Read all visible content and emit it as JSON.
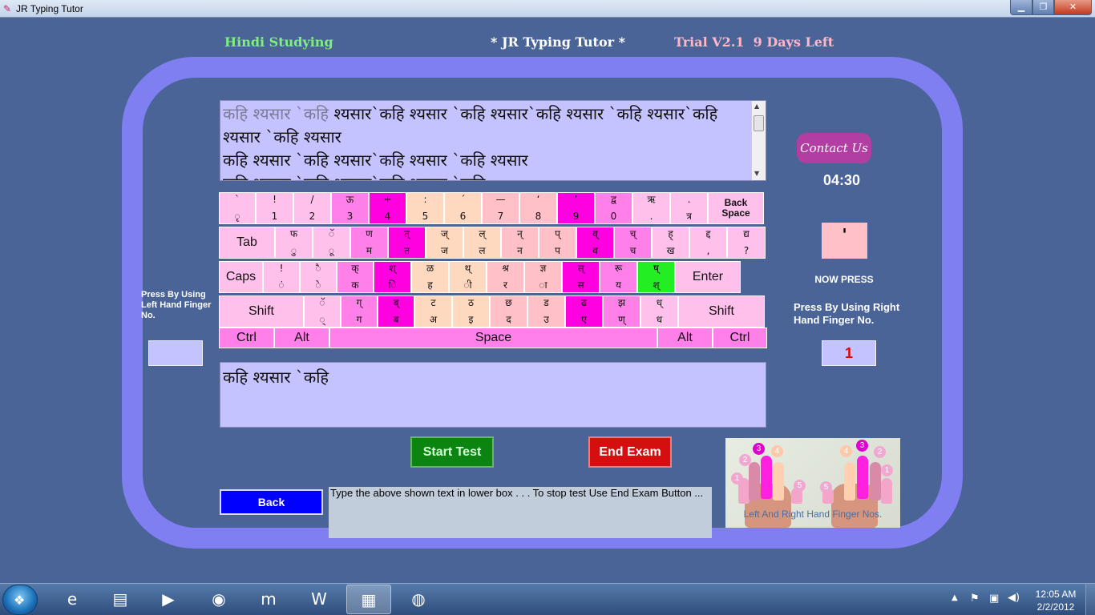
{
  "window": {
    "title": "JR Typing Tutor",
    "icon": "jr-app-icon",
    "min": "▁",
    "max": "❐",
    "close": "✕"
  },
  "header": {
    "mode": "Hindi Studying",
    "app_name": "* JR Typing Tutor *",
    "trial": "Trial V2.1  9 Days Left"
  },
  "source": {
    "typed": "कहि श्यसार `कहि",
    "remaining": " श्यसार`कहि श्यसार `कहि श्यसार`कहि श्यसार `कहि श्यसार`कहि श्यसार `कहि श्यसार\nकहि श्यसार `कहि श्यसार`कहि श्यसार `कहि श्यसार\nकहि श्यसार `कहि श्यसार`कहि श्यसार `कहि",
    "scroll_up": "▲",
    "scroll_down": "▼"
  },
  "keyboard": {
    "rows": [
      [
        {
          "top": "`",
          "bot": "ृ",
          "color": "#ffc0ec"
        },
        {
          "top": "!",
          "bot": "1",
          "color": "#ffc0ec"
        },
        {
          "top": "/",
          "bot": "2",
          "color": "#ffc0ec"
        },
        {
          "top": "ऊ",
          "bot": "3",
          "color": "#ff80e8"
        },
        {
          "top": "+",
          "bot": "4",
          "color": "#ff00e0"
        },
        {
          "top": ":",
          "bot": "5",
          "color": "#ffd8c0"
        },
        {
          "top": "´",
          "bot": "6",
          "color": "#ffd8c0"
        },
        {
          "top": "—",
          "bot": "7",
          "color": "#ffc0c8"
        },
        {
          "top": "‘",
          "bot": "8",
          "color": "#ffc0c8"
        },
        {
          "top": "’",
          "bot": "9",
          "color": "#ff00e0"
        },
        {
          "top": "द्व",
          "bot": "0",
          "color": "#ff80e8"
        },
        {
          "top": "ऋ",
          "bot": ".",
          "color": "#ffc0ec"
        },
        {
          "top": ".",
          "bot": "त्र",
          "color": "#ffc0ec"
        },
        {
          "label": "Back\nSpace",
          "color": "#ffc0ec",
          "name": "backspace"
        }
      ],
      [
        {
          "label": "Tab",
          "color": "#ffc0ec",
          "name": "tab"
        },
        {
          "top": "फ",
          "bot": "ु",
          "color": "#ffc0ec"
        },
        {
          "top": "ॅ",
          "bot": "ू",
          "color": "#ffc0ec"
        },
        {
          "top": "ण",
          "bot": "म",
          "color": "#ff80e8"
        },
        {
          "top": "त्",
          "bot": "त",
          "color": "#ff00e0"
        },
        {
          "top": "ज्",
          "bot": "ज",
          "color": "#ffd8c0"
        },
        {
          "top": "ल्",
          "bot": "ल",
          "color": "#ffd8c0"
        },
        {
          "top": "न्",
          "bot": "न",
          "color": "#ffc0c8"
        },
        {
          "top": "प्",
          "bot": "प",
          "color": "#ffc0c8"
        },
        {
          "top": "व्",
          "bot": "व",
          "color": "#ff00e0"
        },
        {
          "top": "च्",
          "bot": "च",
          "color": "#ff80e8"
        },
        {
          "top": "ह्",
          "bot": "ख",
          "color": "#ffc0ec"
        },
        {
          "top": "द्द",
          "bot": ",",
          "color": "#ffc0ec"
        },
        {
          "top": "द्य",
          "bot": "?",
          "color": "#ffc0ec"
        }
      ],
      [
        {
          "label": "Caps",
          "color": "#ffc0ec",
          "name": "caps"
        },
        {
          "top": "!",
          "bot": "ं",
          "color": "#ffc0ec"
        },
        {
          "top": "ै",
          "bot": "े",
          "color": "#ffc0ec"
        },
        {
          "top": "क्",
          "bot": "क",
          "color": "#ff80e8"
        },
        {
          "top": "श्",
          "bot": "ि",
          "color": "#ff00e0"
        },
        {
          "top": "ळ",
          "bot": "ह",
          "color": "#ffd8c0"
        },
        {
          "top": "थ्",
          "bot": "ी",
          "color": "#ffd8c0"
        },
        {
          "top": "श्र",
          "bot": "र",
          "color": "#ffc0c8"
        },
        {
          "top": "ज्ञ",
          "bot": "ा",
          "color": "#ffc0c8"
        },
        {
          "top": "स्",
          "bot": "स",
          "color": "#ff00e0"
        },
        {
          "top": "रू",
          "bot": "य",
          "color": "#ff80e8"
        },
        {
          "top": "ष्",
          "bot": "श्",
          "color": "#22ee22"
        },
        {
          "label": "Enter",
          "color": "#ffc0ec",
          "name": "enter"
        }
      ],
      [
        {
          "label": "Shift",
          "color": "#ffc0ec",
          "name": "shift-left"
        },
        {
          "top": "ॅ",
          "bot": "्",
          "color": "#ffc0ec"
        },
        {
          "top": "ग्",
          "bot": "ग",
          "color": "#ff80e8"
        },
        {
          "top": "ब्",
          "bot": "ब",
          "color": "#ff00e0"
        },
        {
          "top": "ट",
          "bot": "अ",
          "color": "#ffd8c0"
        },
        {
          "top": "ठ",
          "bot": "इ",
          "color": "#ffd8c0"
        },
        {
          "top": "छ",
          "bot": "द",
          "color": "#ffc0c8"
        },
        {
          "top": "ड",
          "bot": "उ",
          "color": "#ffc0c8"
        },
        {
          "top": "ढ",
          "bot": "ए",
          "color": "#ff00e0"
        },
        {
          "top": "झ",
          "bot": "ण्",
          "color": "#ff80e8"
        },
        {
          "top": "ध्",
          "bot": "ध",
          "color": "#ffc0ec"
        },
        {
          "label": "Shift",
          "color": "#ffc0ec",
          "name": "shift-right"
        }
      ],
      [
        {
          "label": "Ctrl",
          "color": "#ff80e8",
          "name": "ctrl-left"
        },
        {
          "label": "Alt",
          "color": "#ff80e8",
          "name": "alt-left"
        },
        {
          "label": "Space",
          "color": "#ff80e8",
          "name": "space"
        },
        {
          "label": "Alt",
          "color": "#ff80e8",
          "name": "alt-right"
        },
        {
          "label": "Ctrl",
          "color": "#ff80e8",
          "name": "ctrl-right"
        }
      ]
    ]
  },
  "left_hand": {
    "label": "Press By Using Left Hand Finger No.",
    "value": ""
  },
  "right_panel": {
    "contact": "Contact Us",
    "timer": "04:30",
    "next_key": "'",
    "now_press": "NOW PRESS",
    "rh_label": "Press By Using Right Hand  Finger No.",
    "rh_value": "1"
  },
  "input": {
    "text": "कहि श्यसार `कहि"
  },
  "buttons": {
    "start": "Start Test",
    "end": "End Exam",
    "back": "Back"
  },
  "instruction": "Type the above shown text in lower box . . . To stop test Use End Exam Button ...",
  "hands": {
    "caption": "Left And Right Hand Finger Nos.",
    "left_numbers": [
      "1",
      "2",
      "3",
      "4",
      "5"
    ],
    "right_numbers": [
      "5",
      "4",
      "3",
      "2",
      "1"
    ]
  },
  "taskbar": {
    "start_icon": "windows-logo",
    "items": [
      {
        "name": "taskbar-ie",
        "glyph": "e",
        "active": false
      },
      {
        "name": "taskbar-explorer",
        "glyph": "▤",
        "active": false
      },
      {
        "name": "taskbar-media",
        "glyph": "▶",
        "active": false
      },
      {
        "name": "taskbar-firefox",
        "glyph": "◉",
        "active": false
      },
      {
        "name": "taskbar-m-app",
        "glyph": "m",
        "active": false
      },
      {
        "name": "taskbar-word",
        "glyph": "W",
        "active": false
      },
      {
        "name": "taskbar-jr-tutor",
        "glyph": "▦",
        "active": true
      },
      {
        "name": "taskbar-paint",
        "glyph": "◍",
        "active": false
      }
    ],
    "tray": {
      "arrow": "▲",
      "flag": "⚑",
      "network": "▣",
      "volume": "◀)"
    },
    "time": "12:05 AM",
    "date": "2/2/2012"
  },
  "colors": {
    "background": "#4a6498",
    "frame": "#7f7ff2",
    "textbox": "#c5c3ff",
    "accent_key": "#ff00e0",
    "green_key": "#22ee22"
  }
}
